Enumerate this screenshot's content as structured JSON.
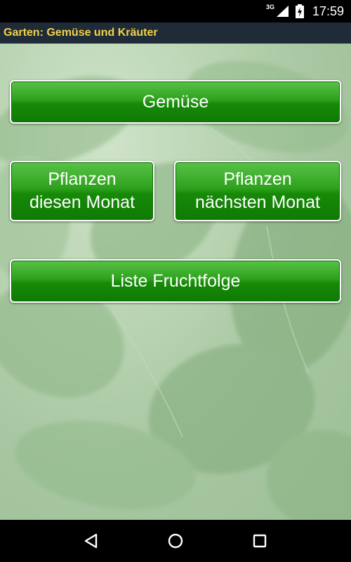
{
  "status_bar": {
    "network_type": "3G",
    "time": "17:59"
  },
  "action_bar": {
    "title": "Garten: Gemüse und Kräuter",
    "title_color": "#f2d24a"
  },
  "buttons": {
    "vegetables": "Gemüse",
    "plant_this_month_line1": "Pflanzen",
    "plant_this_month_line2": "diesen Monat",
    "plant_next_month_line1": "Pflanzen",
    "plant_next_month_line2": "nächsten Monat",
    "crop_rotation": "Liste Fruchtfolge"
  },
  "colors": {
    "button_green": "#1e9a0e",
    "button_border": "#ffffff",
    "background_leaves": "#a8c7a2"
  },
  "icons": {
    "nav_back": "back-triangle-icon",
    "nav_home": "home-circle-icon",
    "nav_recents": "recents-square-icon",
    "signal": "cell-signal-icon",
    "battery": "battery-charging-icon"
  }
}
